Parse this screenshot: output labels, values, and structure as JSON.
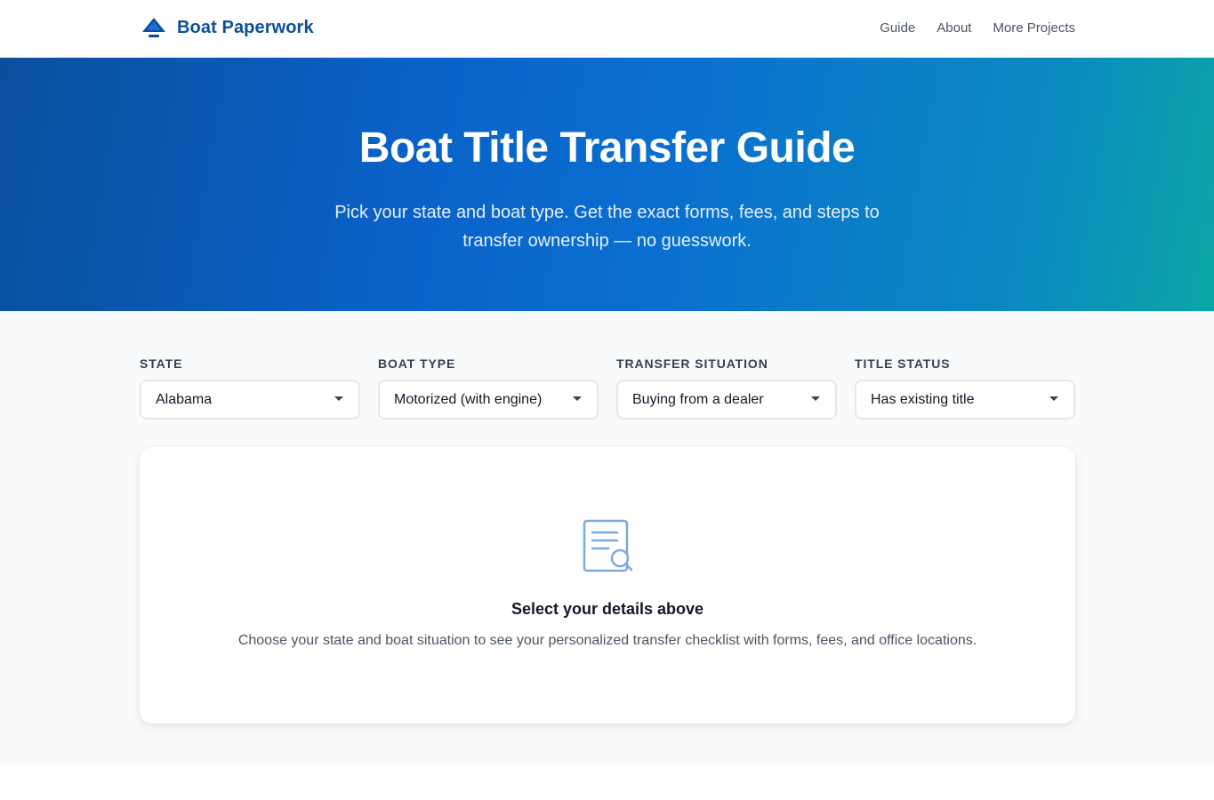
{
  "nav": {
    "brand": "Boat Paperwork",
    "brand_icon": "sailboat-icon",
    "links": [
      "Guide",
      "About",
      "More Projects"
    ]
  },
  "hero": {
    "title": "Boat Title Transfer Guide",
    "subtitle": "Pick your state and boat type. Get the exact forms, fees, and steps to transfer ownership — no guesswork."
  },
  "filters": [
    {
      "label": "STATE",
      "value": "Alabama"
    },
    {
      "label": "BOAT TYPE",
      "value": "Motorized (with engine)"
    },
    {
      "label": "TRANSFER SITUATION",
      "value": "Buying from a dealer"
    },
    {
      "label": "TITLE STATUS",
      "value": "Has existing title"
    }
  ],
  "empty_state": {
    "icon": "document-search-icon",
    "title": "Select your details above",
    "description": "Choose your state and boat situation to see your personalized transfer checklist with forms, fees, and office locations."
  },
  "colors": {
    "brand": "#0b4f9a",
    "hero_start": "#0a4f9c",
    "hero_end": "#0aa7a6",
    "icon_accent": "#7ea9db"
  }
}
